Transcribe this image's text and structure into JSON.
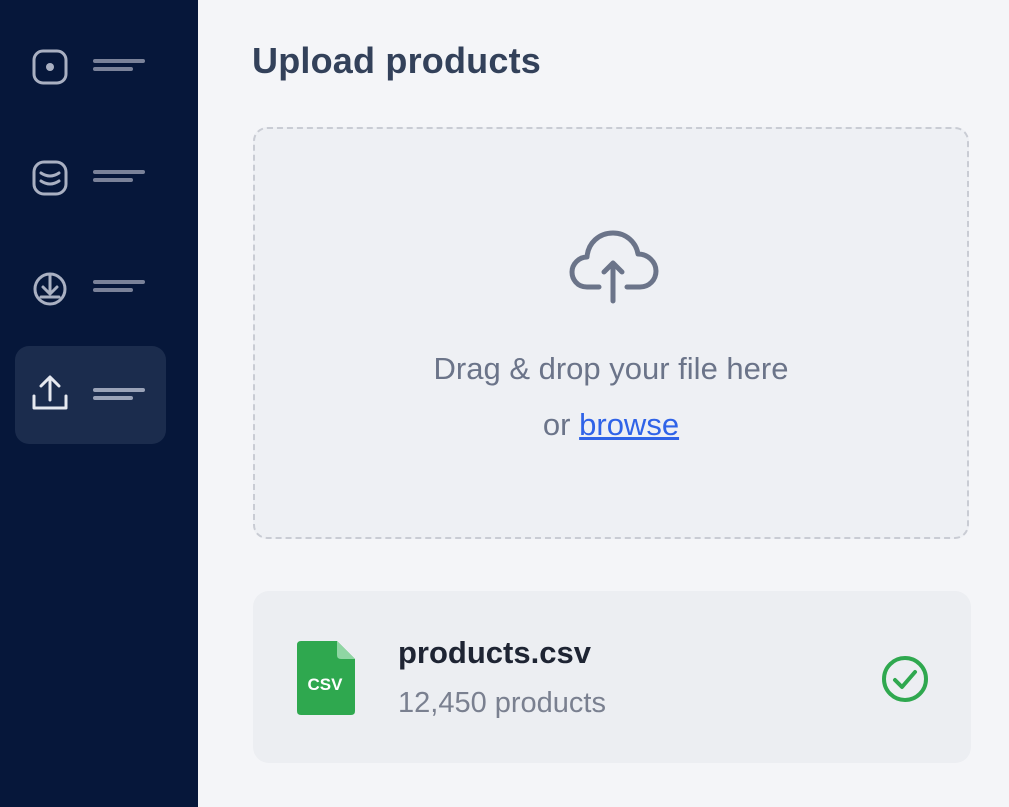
{
  "sidebar": {
    "items": [
      {
        "icon": "dashboard-icon",
        "active": false
      },
      {
        "icon": "database-icon",
        "active": false
      },
      {
        "icon": "import-icon",
        "active": false
      },
      {
        "icon": "upload-icon",
        "active": true
      }
    ]
  },
  "main": {
    "title": "Upload products",
    "dropzone": {
      "icon": "cloud-upload-icon",
      "text": "Drag & drop your file here",
      "or_text": "or",
      "browse_label": "browse"
    },
    "file": {
      "icon": "csv-file-icon",
      "icon_text": "CSV",
      "name": "products.csv",
      "count_text": "12,450 products",
      "status_icon": "check-circle-icon"
    }
  },
  "colors": {
    "sidebar_bg": "#06173a",
    "accent_link": "#2f63e8",
    "success": "#2fa84f",
    "file_icon": "#2fa84f"
  }
}
